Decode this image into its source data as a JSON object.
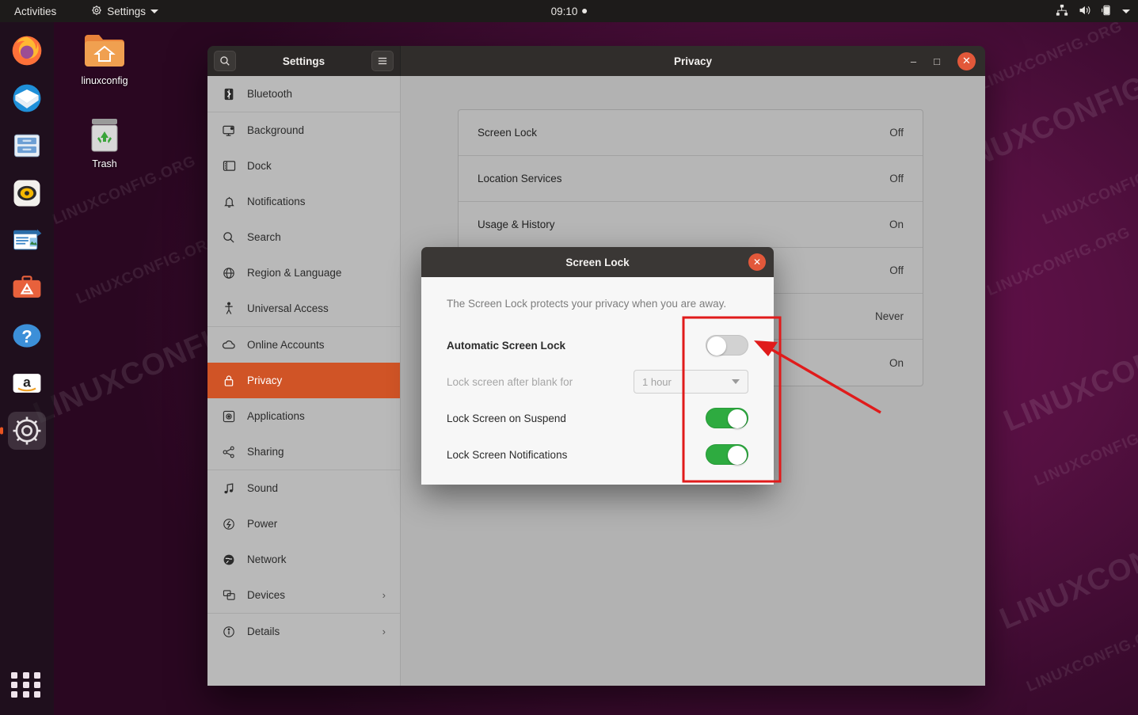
{
  "topbar": {
    "activities": "Activities",
    "app_menu": "Settings",
    "app_menu_icon": "gear-icon",
    "clock": "09:10",
    "notification_dot": "●",
    "tray_icons": [
      "network-icon",
      "volume-icon",
      "battery-icon",
      "chevron-down-icon"
    ]
  },
  "desktop": {
    "icons": [
      {
        "label": "linuxconfig",
        "icon": "home-folder-icon"
      },
      {
        "label": "Trash",
        "icon": "trash-icon"
      }
    ],
    "watermark": "LINUXCONFIG.ORG",
    "background_color": "#4d0d3a"
  },
  "dock": {
    "items": [
      {
        "name": "firefox",
        "active": false
      },
      {
        "name": "thunderbird",
        "active": false
      },
      {
        "name": "files",
        "active": false
      },
      {
        "name": "rhythmbox",
        "active": false
      },
      {
        "name": "libreoffice-writer",
        "active": false
      },
      {
        "name": "ubuntu-software",
        "active": false
      },
      {
        "name": "help",
        "active": false
      },
      {
        "name": "amazon",
        "active": false
      },
      {
        "name": "settings",
        "active": true
      }
    ],
    "show_applications": "show-applications-icon"
  },
  "window": {
    "sidebar_title": "Settings",
    "panel_title": "Privacy",
    "search_icon": "search-icon",
    "menu_icon": "hamburger-menu-icon",
    "controls": {
      "minimize": "–",
      "maximize": "□",
      "close": "✕"
    }
  },
  "sidebar": {
    "items": [
      {
        "label": "Bluetooth",
        "icon": "bluetooth-icon",
        "selected": false,
        "chevron": ""
      },
      {
        "label": "Background",
        "icon": "background-icon",
        "selected": false,
        "chevron": ""
      },
      {
        "label": "Dock",
        "icon": "dock-icon",
        "selected": false,
        "chevron": ""
      },
      {
        "label": "Notifications",
        "icon": "bell-icon",
        "selected": false,
        "chevron": ""
      },
      {
        "label": "Search",
        "icon": "search-icon",
        "selected": false,
        "chevron": ""
      },
      {
        "label": "Region & Language",
        "icon": "globe-icon",
        "selected": false,
        "chevron": ""
      },
      {
        "label": "Universal Access",
        "icon": "accessibility-icon",
        "selected": false,
        "chevron": ""
      },
      {
        "label": "Online Accounts",
        "icon": "cloud-icon",
        "selected": false,
        "chevron": ""
      },
      {
        "label": "Privacy",
        "icon": "lock-icon",
        "selected": true,
        "chevron": ""
      },
      {
        "label": "Applications",
        "icon": "applications-icon",
        "selected": false,
        "chevron": ""
      },
      {
        "label": "Sharing",
        "icon": "share-icon",
        "selected": false,
        "chevron": ""
      },
      {
        "label": "Sound",
        "icon": "sound-icon",
        "selected": false,
        "chevron": ""
      },
      {
        "label": "Power",
        "icon": "power-icon",
        "selected": false,
        "chevron": ""
      },
      {
        "label": "Network",
        "icon": "network-globe-icon",
        "selected": false,
        "chevron": ""
      },
      {
        "label": "Devices",
        "icon": "devices-icon",
        "selected": false,
        "chevron": "›"
      },
      {
        "label": "Details",
        "icon": "info-icon",
        "selected": false,
        "chevron": "›"
      }
    ],
    "selected_color": "#d05426"
  },
  "privacy_panel": {
    "rows": [
      {
        "label": "Screen Lock",
        "value": "Off"
      },
      {
        "label": "Location Services",
        "value": "Off"
      },
      {
        "label": "Usage & History",
        "value": "On"
      },
      {
        "label": "",
        "value": "Off"
      },
      {
        "label": "",
        "value": "Never"
      },
      {
        "label": "",
        "value": "On"
      }
    ]
  },
  "dialog": {
    "title": "Screen Lock",
    "close_icon": "close-icon",
    "description": "The Screen Lock protects your privacy when you are away.",
    "rows": [
      {
        "label": "Automatic Screen Lock",
        "control": "toggle",
        "state": "off",
        "disabled": false,
        "bold": true
      },
      {
        "label": "Lock screen after blank for",
        "control": "select",
        "value": "1 hour",
        "disabled": true,
        "bold": false
      },
      {
        "label": "Lock Screen on Suspend",
        "control": "toggle",
        "state": "on",
        "disabled": false,
        "bold": false
      },
      {
        "label": "Lock Screen Notifications",
        "control": "toggle",
        "state": "on",
        "disabled": false,
        "bold": false
      }
    ],
    "toggle_on_color": "#2eab40",
    "toggle_off_color": "#d2d2d2"
  },
  "annotation": {
    "highlight_color": "#e01b1b",
    "shape": "rectangle-with-arrow",
    "target": "automatic-screen-lock-toggle"
  }
}
